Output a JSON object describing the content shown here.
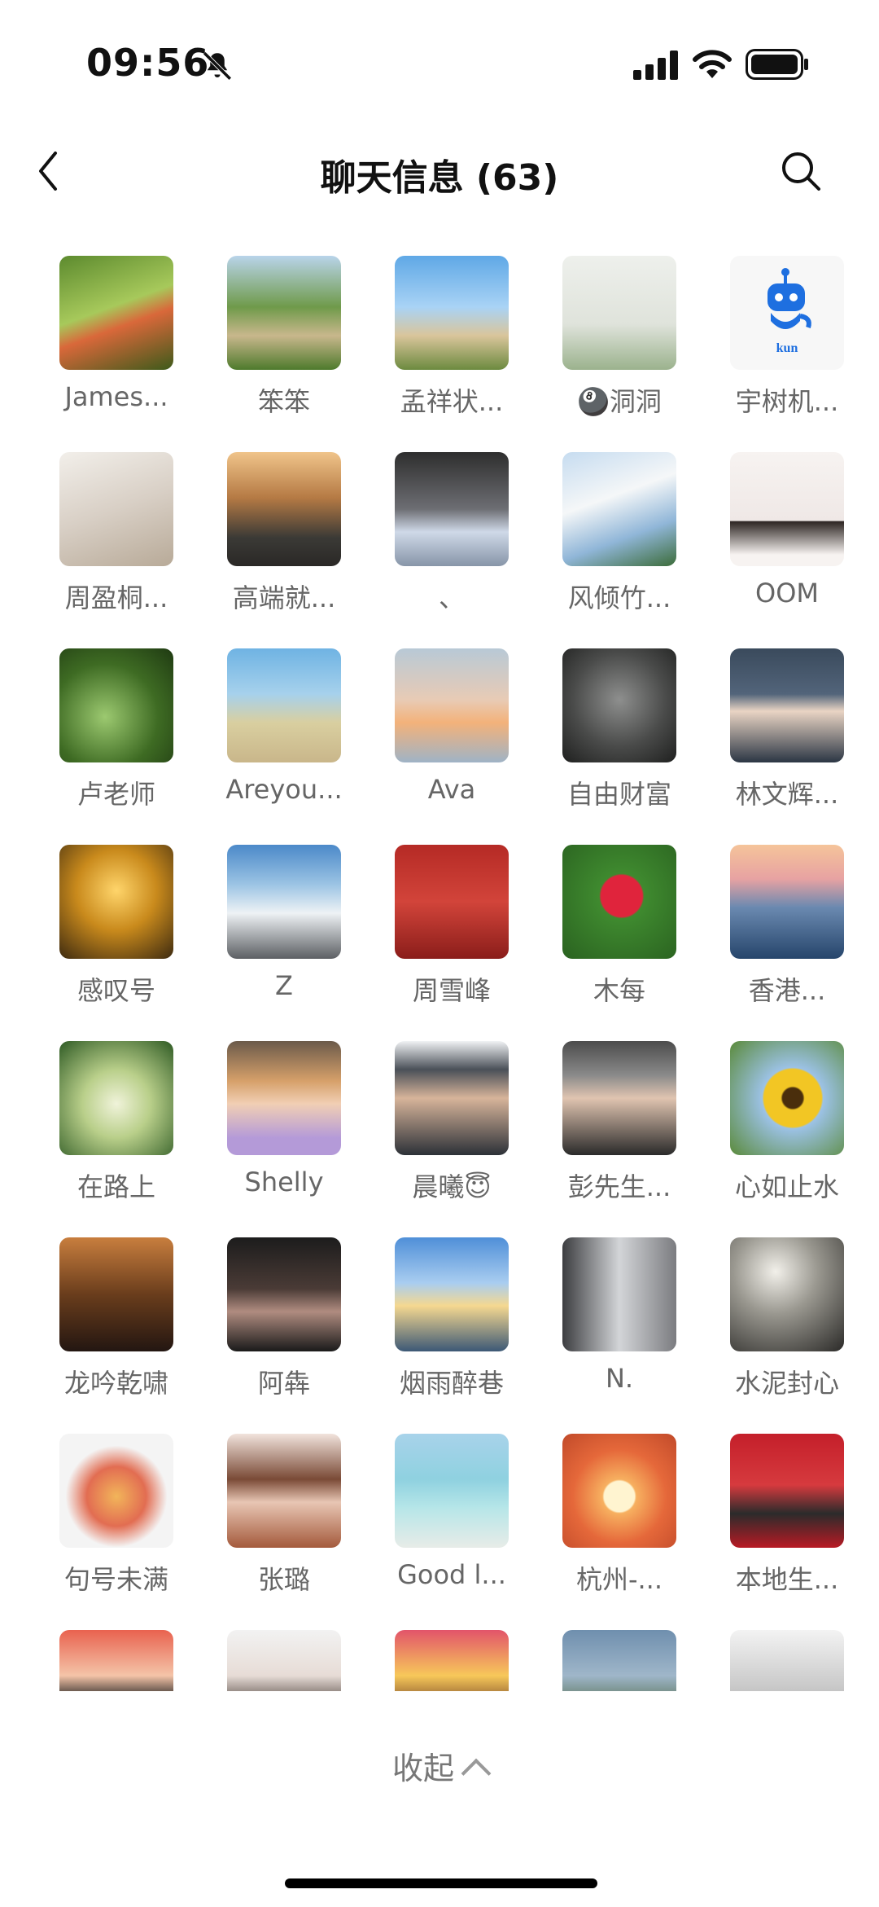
{
  "status_bar": {
    "time": "09:56"
  },
  "header": {
    "title": "聊天信息 (63)"
  },
  "members": [
    {
      "name": "James...",
      "bg": "linear-gradient(160deg,#5c8a2e,#a7c95b 45%,#d9683a 60%,#3d5a1a)"
    },
    {
      "name": "笨笨",
      "bg": "linear-gradient(180deg,#b9d4ea 0%,#6f9a4a 45%,#c8b78c 70%,#4e7a2c)"
    },
    {
      "name": "孟祥状...",
      "bg": "linear-gradient(180deg,#5fa8e6 0%,#a9d3f5 45%,#d9c59b 70%,#6c8a3f)"
    },
    {
      "name": "🎱洞洞",
      "bg": "linear-gradient(180deg,#eef0ec,#dfe3db 60%,#9bb28d)"
    },
    {
      "name": "宇树机...",
      "bg": "robot"
    },
    {
      "name": "周盈桐...",
      "bg": "linear-gradient(160deg,#f2efea,#d8cfc5 50%,#b8aa98)"
    },
    {
      "name": "高端就...",
      "bg": "linear-gradient(180deg,#f0c48a 0%,#b57a44 40%,#3b3a36 75%,#2a2826)"
    },
    {
      "name": "、",
      "bg": "linear-gradient(180deg,#2e2e2e,#6d6e73 50%,#cfd9e8 70%,#8795a8)"
    },
    {
      "name": "风倾竹...",
      "bg": "linear-gradient(160deg,#c6dcf0,#f5f7f8 40%,#90b6d8 70%,#3c6c3a)"
    },
    {
      "name": "OOM",
      "bg": "linear-gradient(180deg,#f7f3f1,#efe8e6 60%,#2d2522 61%,#f7f3f1 90%)"
    },
    {
      "name": "卢老师",
      "bg": "radial-gradient(circle at 40% 60%,#9cc970,#3e6b23 55%,#1f3a12)"
    },
    {
      "name": "Areyou...",
      "bg": "linear-gradient(180deg,#6fb3e3 0%,#a6d1ec 40%,#d9cfa0 65%,#c9b68a)"
    },
    {
      "name": "Ava",
      "bg": "linear-gradient(180deg,#b8c9d6 0%,#e8cbb5 45%,#f3b27a 65%,#9fb3c6)"
    },
    {
      "name": "自由财富",
      "bg": "radial-gradient(circle at 50% 45%,#8e8f8e,#4a4b4a 55%,#1f201f)"
    },
    {
      "name": "林文辉...",
      "bg": "linear-gradient(180deg,#3a4a5c,#52647a 40%,#e9d4c4 55%,#2b3644)"
    },
    {
      "name": "感叹号",
      "bg": "radial-gradient(circle at 50% 40%,#ffd56b,#c98a1c 45%,#3d2a10)"
    },
    {
      "name": "Z",
      "bg": "linear-gradient(180deg,#4b89c9 0%,#9cc4e4 35%,#eef2f5 60%,#5c5f63)"
    },
    {
      "name": "周雪峰",
      "bg": "linear-gradient(180deg,#b52a25,#d2443a 50%,#8a1d1a)"
    },
    {
      "name": "木每",
      "bg": "radial-gradient(circle at 52% 45%,#e0243c 0 24%,#3f8a2f 26%,#2a6220)"
    },
    {
      "name": "香港...",
      "bg": "linear-gradient(180deg,#f5c49a 0%,#e7a2a2 30%,#6a89b0 55%,#26456b)"
    },
    {
      "name": "在路上",
      "bg": "radial-gradient(circle at 50% 55%,#f0f3da,#b9cf8a 40%,#2e5a24)"
    },
    {
      "name": "Shelly",
      "bg": "linear-gradient(180deg,#6b5a4a,#d6a06a 35%,#f1cfb4 55%,#b49ad8 85%)"
    },
    {
      "name": "晨曦😇",
      "bg": "linear-gradient(180deg,#f0f2f4 0%,#4a5058 25%,#d7b49a 50%,#2c3138)"
    },
    {
      "name": "彭先生...",
      "bg": "linear-gradient(180deg,#4c4c4c,#8a8a8a 30%,#e0c4b0 50%,#2a2a2a)"
    },
    {
      "name": "心如止水",
      "bg": "radial-gradient(circle at 55% 50%,#4a2e0c 0 12%,#f2c624 14% 34%,#9cc2e6 36%,#5a8a3a)"
    },
    {
      "name": "龙吟乾啸",
      "bg": "linear-gradient(180deg,#c87e3e,#6a3d1c 50%,#231611)"
    },
    {
      "name": "阿犇",
      "bg": "linear-gradient(180deg,#1c1c1c,#4a3b36 45%,#b08c80 65%,#1a1a1a)"
    },
    {
      "name": "烟雨醉巷",
      "bg": "linear-gradient(180deg,#4f8fd8 0%,#a9cdf0 40%,#f5d890 60%,#3c5876)"
    },
    {
      "name": "N.",
      "bg": "linear-gradient(90deg,#3c3d40,#d3d5d8 50%,#7b7c80)"
    },
    {
      "name": "水泥封心",
      "bg": "radial-gradient(circle at 40% 30%,#f2f0ea,#9a9890 40%,#2b2a28)"
    },
    {
      "name": "句号未满",
      "bg": "radial-gradient(circle at 50% 55%,#f2b55a,#e26d52 35%,#f4f4f4 60%)"
    },
    {
      "name": "张璐",
      "bg": "linear-gradient(180deg,#f1e3dc,#7a4a36 40%,#e8c6b4 60%,#a45a3c)"
    },
    {
      "name": "Good l...",
      "bg": "linear-gradient(180deg,#a8d3ea 0%,#8fd1e0 40%,#b6e6e8 65%,#e7ece8)"
    },
    {
      "name": "杭州-...",
      "bg": "radial-gradient(circle at 50% 55%,#fff4d0 0 18%,#f7b060 20%,#e5683a 55%,#c14a2a)"
    },
    {
      "name": "本地生...",
      "bg": "linear-gradient(180deg,#c41f2a,#d63a3e 45%,#2b2b2b 70%,#b81a24)"
    },
    {
      "name": "",
      "bg": "linear-gradient(180deg,#e9624f,#f4c4a8 40%,#2d2a28 60%)"
    },
    {
      "name": "",
      "bg": "linear-gradient(180deg,#f2f2f2,#e7dcd6 40%,#3a2f2a 70%)"
    },
    {
      "name": "",
      "bg": "linear-gradient(180deg,#e2546a,#f7c85a 40%,#6b3a22 70%)"
    },
    {
      "name": "",
      "bg": "linear-gradient(180deg,#6f8fae,#9fb6c9 40%,#4f6a4a 70%)"
    },
    {
      "name": "",
      "bg": "linear-gradient(180deg,#f3f3f3,#c9c9c9 50%,#8a8a8a)"
    }
  ],
  "collapse_label": "收起",
  "robot_avatar": {
    "text": "kun",
    "color": "#1e6fe0"
  }
}
